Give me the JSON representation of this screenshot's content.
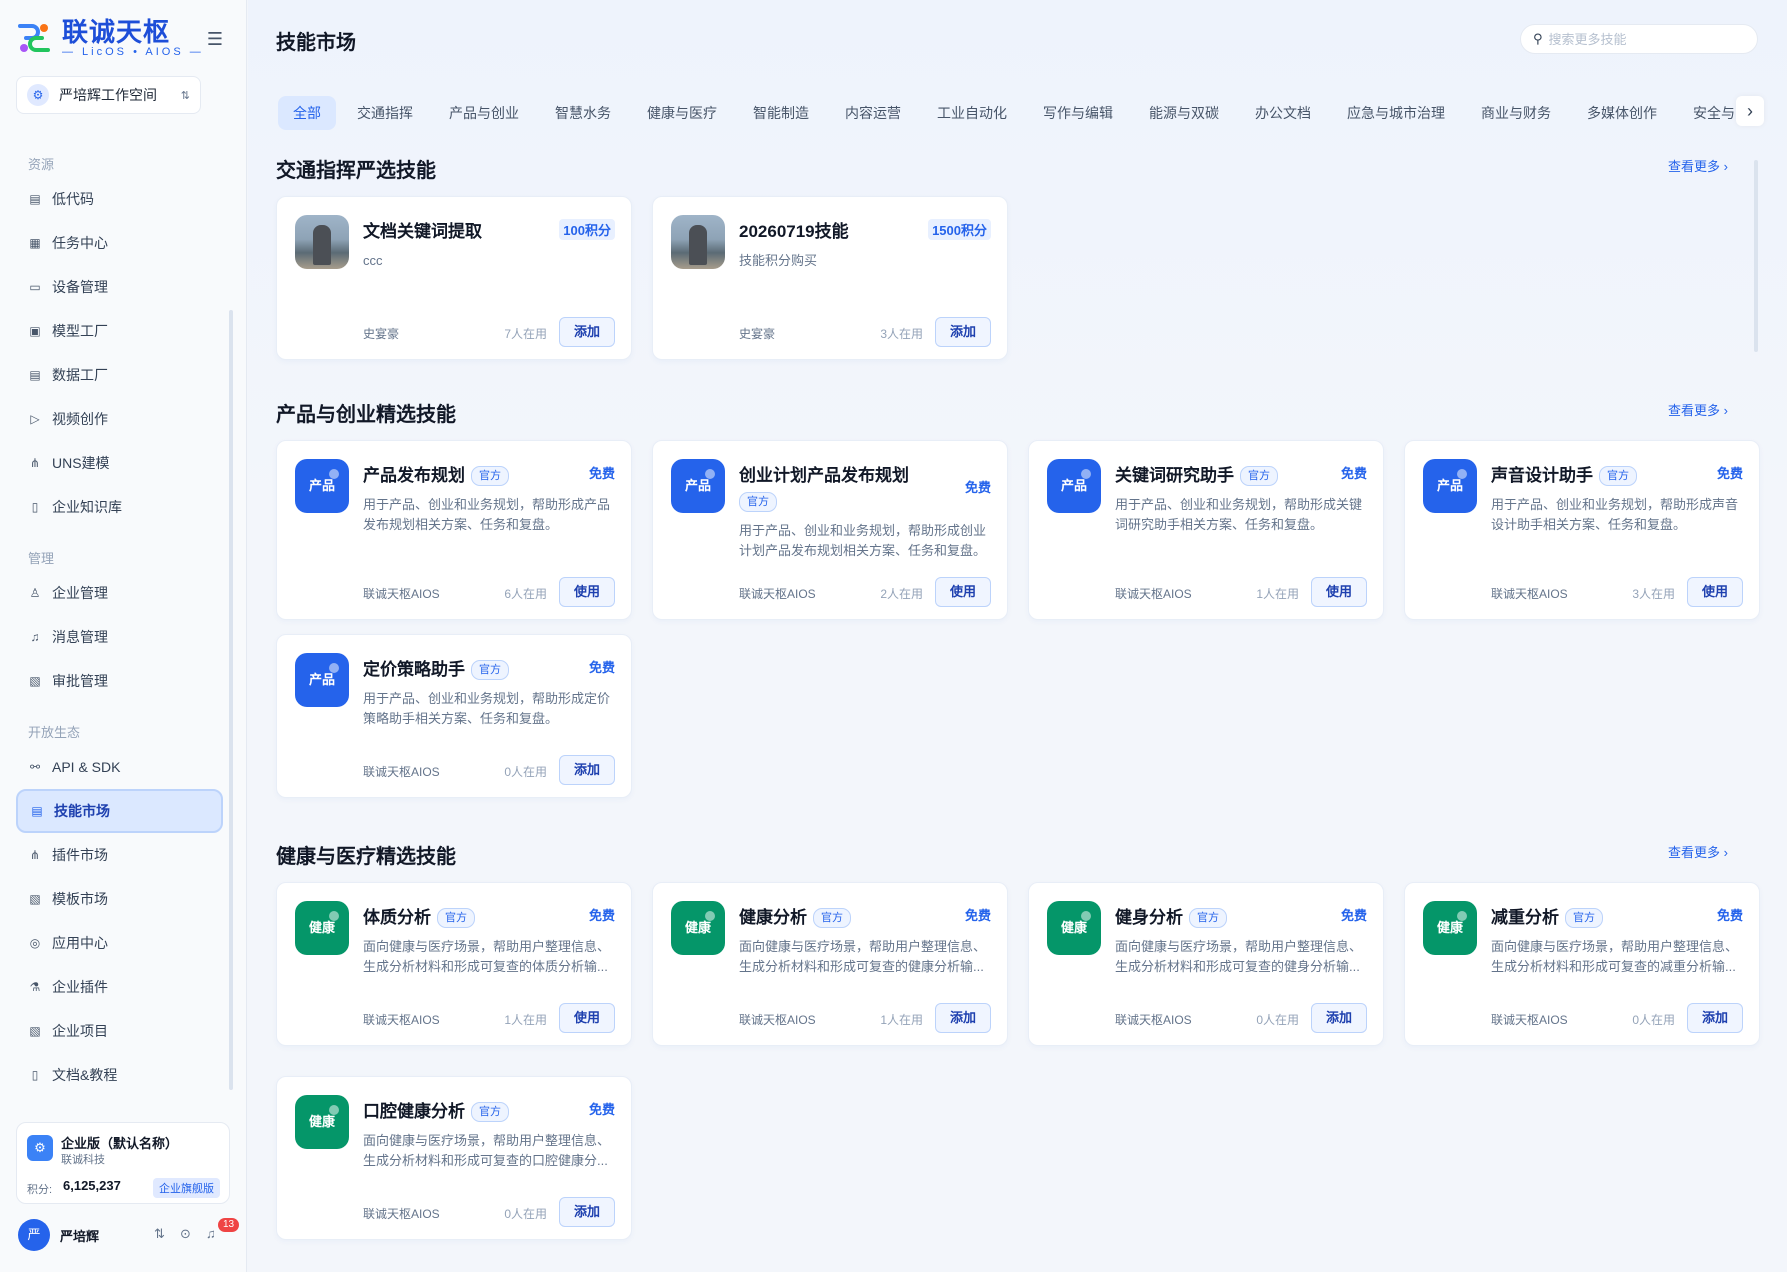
{
  "brand": {
    "name_cn": "联诚天枢",
    "name_en": "— LicOS • AIOS —"
  },
  "workspace": {
    "name": "严培辉工作空间"
  },
  "sidebar": {
    "sections": [
      {
        "label": "资源"
      },
      {
        "label": "管理"
      },
      {
        "label": "开放生态"
      }
    ],
    "items": [
      {
        "label": "低代码"
      },
      {
        "label": "任务中心"
      },
      {
        "label": "设备管理"
      },
      {
        "label": "模型工厂"
      },
      {
        "label": "数据工厂"
      },
      {
        "label": "视频创作"
      },
      {
        "label": "UNS建模"
      },
      {
        "label": "企业知识库"
      },
      {
        "label": "企业管理"
      },
      {
        "label": "消息管理"
      },
      {
        "label": "审批管理"
      },
      {
        "label": "API & SDK"
      },
      {
        "label": "技能市场"
      },
      {
        "label": "插件市场"
      },
      {
        "label": "模板市场"
      },
      {
        "label": "应用中心"
      },
      {
        "label": "企业插件"
      },
      {
        "label": "企业项目"
      },
      {
        "label": "文档&教程"
      }
    ],
    "active": "技能市场"
  },
  "plan": {
    "name": "企业版（默认名称）",
    "org": "联诚科技",
    "points_label": "积分:",
    "points": "6,125,237",
    "badge": "企业旗舰版"
  },
  "user": {
    "avatar": "严",
    "name": "严培辉",
    "notifications": "13"
  },
  "header": {
    "title": "技能市场"
  },
  "search": {
    "placeholder": "搜索更多技能"
  },
  "tabs": [
    "全部",
    "交通指挥",
    "产品与创业",
    "智慧水务",
    "健康与医疗",
    "智能制造",
    "内容运营",
    "工业自动化",
    "写作与编辑",
    "能源与双碳",
    "办公文档",
    "应急与城市治理",
    "商业与财务",
    "多媒体创作",
    "安全与"
  ],
  "more_label": "查看更多 ›",
  "sections": [
    {
      "title": "交通指挥严选技能",
      "cards": [
        {
          "name": "文档关键词提取",
          "official": "",
          "price": "100积分",
          "desc": "ccc",
          "author": "史宴豪",
          "users": "7人在用",
          "action": "添加"
        },
        {
          "name": "20260719技能",
          "official": "",
          "price": "1500积分",
          "desc": "技能积分购买",
          "author": "史宴豪",
          "users": "3人在用",
          "action": "添加"
        }
      ]
    },
    {
      "title": "产品与创业精选技能",
      "icon_text": "产品",
      "cards": [
        {
          "name": "产品发布规划",
          "official": "官方",
          "price": "免费",
          "desc": "用于产品、创业和业务规划，帮助形成产品发布规划相关方案、任务和复盘。",
          "author": "联诚天枢AIOS",
          "users": "6人在用",
          "action": "使用"
        },
        {
          "name": "创业计划产品发布规划",
          "official": "官方",
          "price": "免费",
          "desc": "用于产品、创业和业务规划，帮助形成创业计划产品发布规划相关方案、任务和复盘。",
          "author": "联诚天枢AIOS",
          "users": "2人在用",
          "action": "使用"
        },
        {
          "name": "关键词研究助手",
          "official": "官方",
          "price": "免费",
          "desc": "用于产品、创业和业务规划，帮助形成关键词研究助手相关方案、任务和复盘。",
          "author": "联诚天枢AIOS",
          "users": "1人在用",
          "action": "使用"
        },
        {
          "name": "声音设计助手",
          "official": "官方",
          "price": "免费",
          "desc": "用于产品、创业和业务规划，帮助形成声音设计助手相关方案、任务和复盘。",
          "author": "联诚天枢AIOS",
          "users": "3人在用",
          "action": "使用"
        },
        {
          "name": "定价策略助手",
          "official": "官方",
          "price": "免费",
          "desc": "用于产品、创业和业务规划，帮助形成定价策略助手相关方案、任务和复盘。",
          "author": "联诚天枢AIOS",
          "users": "0人在用",
          "action": "添加"
        }
      ]
    },
    {
      "title": "健康与医疗精选技能",
      "icon_text": "健康",
      "cards": [
        {
          "name": "体质分析",
          "official": "官方",
          "price": "免费",
          "desc": "面向健康与医疗场景，帮助用户整理信息、生成分析材料和形成可复查的体质分析输...",
          "author": "联诚天枢AIOS",
          "users": "1人在用",
          "action": "使用"
        },
        {
          "name": "健康分析",
          "official": "官方",
          "price": "免费",
          "desc": "面向健康与医疗场景，帮助用户整理信息、生成分析材料和形成可复查的健康分析输...",
          "author": "联诚天枢AIOS",
          "users": "1人在用",
          "action": "添加"
        },
        {
          "name": "健身分析",
          "official": "官方",
          "price": "免费",
          "desc": "面向健康与医疗场景，帮助用户整理信息、生成分析材料和形成可复查的健身分析输...",
          "author": "联诚天枢AIOS",
          "users": "0人在用",
          "action": "添加"
        },
        {
          "name": "减重分析",
          "official": "官方",
          "price": "免费",
          "desc": "面向健康与医疗场景，帮助用户整理信息、生成分析材料和形成可复查的减重分析输...",
          "author": "联诚天枢AIOS",
          "users": "0人在用",
          "action": "添加"
        },
        {
          "name": "口腔健康分析",
          "official": "官方",
          "price": "免费",
          "desc": "面向健康与医疗场景，帮助用户整理信息、生成分析材料和形成可复查的口腔健康分...",
          "author": "联诚天枢AIOS",
          "users": "0人在用",
          "action": "添加"
        }
      ]
    }
  ],
  "colors": {
    "accent": "#2563eb",
    "product_icon": "#2563eb",
    "health_icon": "#059669"
  }
}
